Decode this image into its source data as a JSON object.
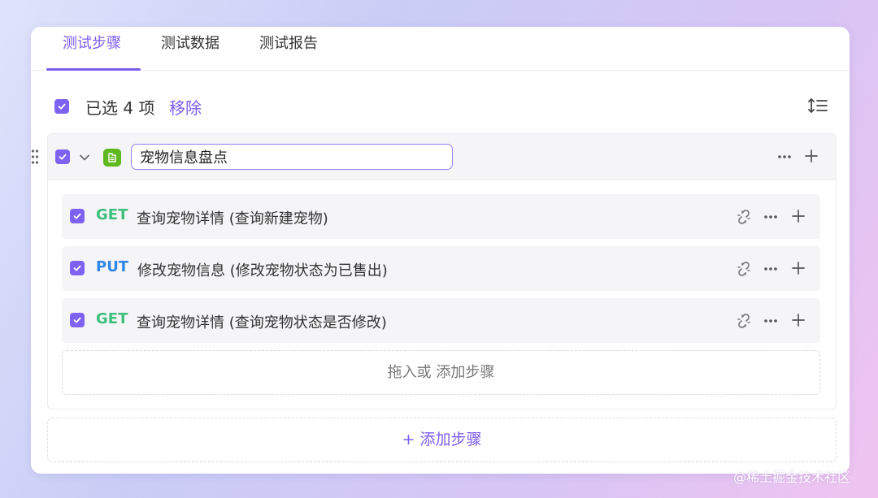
{
  "tabs": [
    {
      "label": "测试步骤",
      "active": true
    },
    {
      "label": "测试数据",
      "active": false
    },
    {
      "label": "测试报告",
      "active": false
    }
  ],
  "selection": {
    "summary": "已选 4 项",
    "remove_label": "移除"
  },
  "group": {
    "name": "宠物信息盘点",
    "icon": "folder-icon",
    "steps": [
      {
        "method": "GET",
        "name": "查询宠物详情 (查询新建宠物)"
      },
      {
        "method": "PUT",
        "name": "修改宠物信息 (修改宠物状态为已售出)"
      },
      {
        "method": "GET",
        "name": "查询宠物详情 (查询宠物状态是否修改)"
      }
    ],
    "drop_zone": "拖入或 添加步骤"
  },
  "add_step_label": "+ 添加步骤",
  "watermark": "@稀土掘金技术社区",
  "colors": {
    "accent": "#7b5cf0",
    "get": "#3dbf7e",
    "put": "#2e86e8",
    "folder": "#5fb81f"
  }
}
